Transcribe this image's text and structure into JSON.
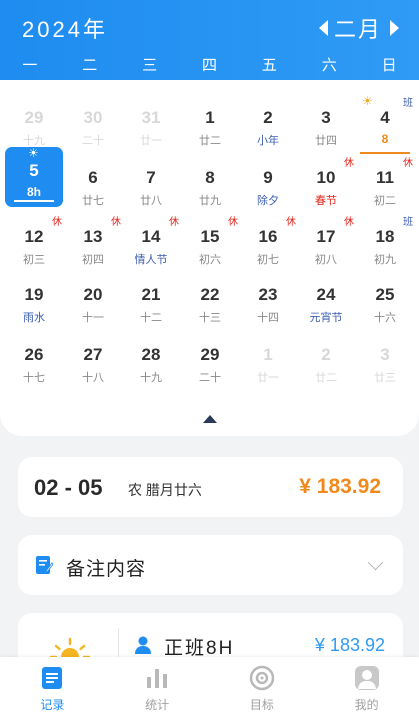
{
  "header": {
    "year": "2024年",
    "month": "二月",
    "weekdays": [
      "一",
      "二",
      "三",
      "四",
      "五",
      "六",
      "日"
    ]
  },
  "calendar": {
    "rows": [
      [
        {
          "day": "29",
          "lunar": "十九",
          "style": "dim"
        },
        {
          "day": "30",
          "lunar": "二十",
          "style": "dim"
        },
        {
          "day": "31",
          "lunar": "廿一",
          "style": "dim"
        },
        {
          "day": "1",
          "lunar": "廿二"
        },
        {
          "day": "2",
          "lunar": "小年",
          "lunar_color": "blue"
        },
        {
          "day": "3",
          "lunar": "廿四"
        },
        {
          "day": "4",
          "lunar": "8",
          "lunar_color": "orange",
          "tag": "班",
          "tag_color": "blue",
          "sun": true
        }
      ],
      [
        {
          "day": "5",
          "lunar": "8h",
          "selected": true,
          "sun": true
        },
        {
          "day": "6",
          "lunar": "廿七"
        },
        {
          "day": "7",
          "lunar": "廿八"
        },
        {
          "day": "8",
          "lunar": "廿九"
        },
        {
          "day": "9",
          "lunar": "除夕",
          "lunar_color": "blue"
        },
        {
          "day": "10",
          "lunar": "春节",
          "lunar_color": "red",
          "tag": "休",
          "tag_color": "red"
        },
        {
          "day": "11",
          "lunar": "初二",
          "tag": "休",
          "tag_color": "red"
        }
      ],
      [
        {
          "day": "12",
          "lunar": "初三",
          "tag": "休",
          "tag_color": "red"
        },
        {
          "day": "13",
          "lunar": "初四",
          "tag": "休",
          "tag_color": "red"
        },
        {
          "day": "14",
          "lunar": "情人节",
          "lunar_color": "blue",
          "tag": "休",
          "tag_color": "red"
        },
        {
          "day": "15",
          "lunar": "初六",
          "tag": "休",
          "tag_color": "red"
        },
        {
          "day": "16",
          "lunar": "初七",
          "tag": "休",
          "tag_color": "red"
        },
        {
          "day": "17",
          "lunar": "初八",
          "tag": "休",
          "tag_color": "red"
        },
        {
          "day": "18",
          "lunar": "初九",
          "tag": "班",
          "tag_color": "blue"
        }
      ],
      [
        {
          "day": "19",
          "lunar": "雨水",
          "lunar_color": "blue"
        },
        {
          "day": "20",
          "lunar": "十一"
        },
        {
          "day": "21",
          "lunar": "十二"
        },
        {
          "day": "22",
          "lunar": "十三"
        },
        {
          "day": "23",
          "lunar": "十四"
        },
        {
          "day": "24",
          "lunar": "元宵节",
          "lunar_color": "blue"
        },
        {
          "day": "25",
          "lunar": "十六"
        }
      ],
      [
        {
          "day": "26",
          "lunar": "十七"
        },
        {
          "day": "27",
          "lunar": "十八"
        },
        {
          "day": "28",
          "lunar": "十九"
        },
        {
          "day": "29",
          "lunar": "二十"
        },
        {
          "day": "1",
          "lunar": "廿一",
          "style": "dim"
        },
        {
          "day": "2",
          "lunar": "廿二",
          "style": "dim"
        },
        {
          "day": "3",
          "lunar": "廿三",
          "style": "dim"
        }
      ]
    ]
  },
  "selected_date": {
    "date": "02 - 05",
    "lunar": "农  腊月廿六",
    "amount": "¥ 183.92"
  },
  "note": {
    "label": "备注内容"
  },
  "shift": {
    "label": "正班8H",
    "amount": "¥ 183.92"
  },
  "tabs": [
    {
      "label": "记录",
      "active": true,
      "icon": "record-icon"
    },
    {
      "label": "统计",
      "icon": "stats-icon"
    },
    {
      "label": "目标",
      "icon": "target-icon"
    },
    {
      "label": "我的",
      "icon": "profile-icon"
    }
  ],
  "colors": {
    "primary": "#1e8cf0",
    "accent_orange": "#f08a1c",
    "holiday_red": "#e0251b",
    "festival_blue": "#3d5fb0"
  }
}
